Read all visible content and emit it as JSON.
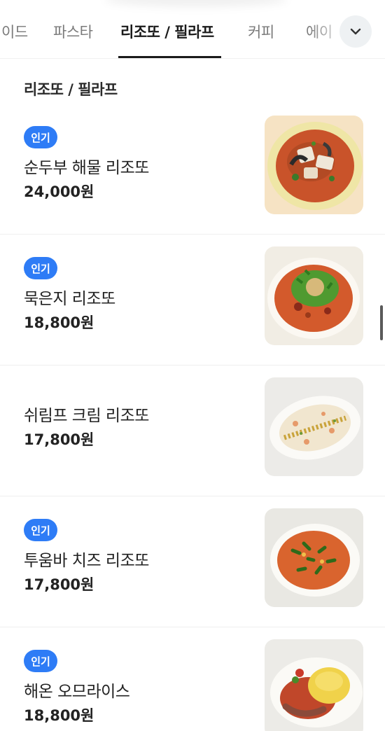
{
  "tabs": [
    {
      "label": "이드",
      "active": false
    },
    {
      "label": "파스타",
      "active": false
    },
    {
      "label": "리조또 / 필라프",
      "active": true
    },
    {
      "label": "커피",
      "active": false
    },
    {
      "label": "에이",
      "active": false
    }
  ],
  "expand_icon": "chevron-down-icon",
  "section_title": "리조또 / 필라프",
  "items": [
    {
      "badge": "인기",
      "name": "순두부 해물 리조또",
      "price": "24,000원",
      "image": "tomato-seafood-risotto"
    },
    {
      "badge": "인기",
      "name": "묵은지 리조또",
      "price": "18,800원",
      "image": "kimchi-risotto-greens"
    },
    {
      "badge": "",
      "name": "쉬림프 크림 리조또",
      "price": "17,800원",
      "image": "shrimp-cream-risotto"
    },
    {
      "badge": "인기",
      "name": "투움바 치즈 리조또",
      "price": "17,800원",
      "image": "toowoomba-cheese-risotto"
    },
    {
      "badge": "인기",
      "name": "해온 오므라이스",
      "price": "18,800원",
      "image": "omurice-with-sauce"
    }
  ],
  "colors": {
    "badge": "#2e7cf6",
    "active_tab": "#1a1a1a",
    "inactive_tab": "#7a7a7a"
  }
}
